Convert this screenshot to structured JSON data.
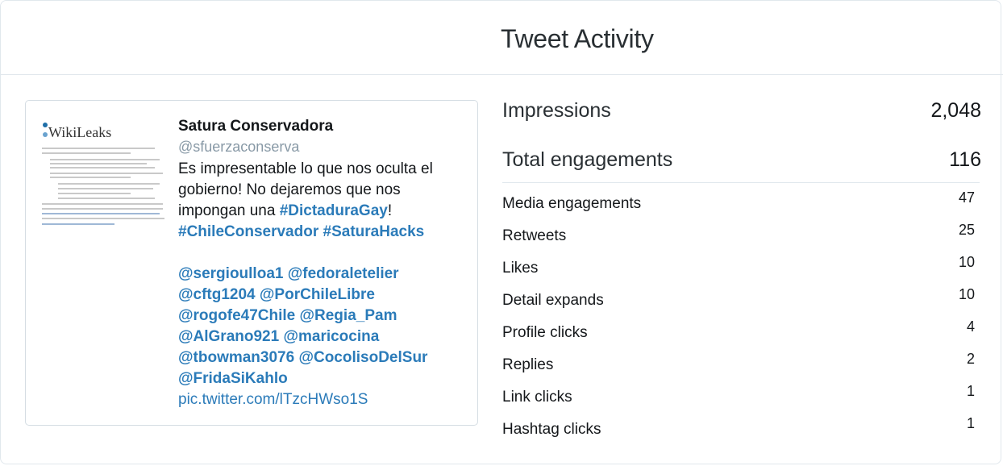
{
  "header": {
    "title": "Tweet Activity"
  },
  "tweet": {
    "thumbnail_logo": "WikiLeaks",
    "author_name": "Satura Conservadora",
    "author_handle": "@sfuerzaconserva",
    "text_part1": "Es impresentable lo que nos oculta el gobierno! No dejaremos que nos impongan una ",
    "hashtag1": "#DictaduraGay",
    "text_part2": "!",
    "hashtag2": "#ChileConservador",
    "hashtag3": "#SaturaHacks",
    "mention_lines": [
      "@sergioulloa1 @fedoraletelier",
      "@cftg1204 @PorChileLibre",
      "@rogofe47Chile @Regia_Pam",
      "@AlGrano921 @maricocina",
      "@tbowman3076 @CocolisoDelSur",
      "@FridaSiKahlo"
    ],
    "media_link": "pic.twitter.com/lTzcHWso1S"
  },
  "stats": {
    "impressions_label": "Impressions",
    "impressions_value": "2,048",
    "engagements_label": "Total engagements",
    "engagements_value": "116",
    "breakdown": [
      {
        "label": "Media engagements",
        "value": "47"
      },
      {
        "label": "Retweets",
        "value": "25"
      },
      {
        "label": "Likes",
        "value": "10"
      },
      {
        "label": "Detail expands",
        "value": "10"
      },
      {
        "label": "Profile clicks",
        "value": "4"
      },
      {
        "label": "Replies",
        "value": "2"
      },
      {
        "label": "Link clicks",
        "value": "1"
      },
      {
        "label": "Hashtag clicks",
        "value": "1"
      }
    ]
  },
  "colors": {
    "link": "#2b7bb9",
    "muted": "#8899a6",
    "border": "#e1e8ed"
  }
}
